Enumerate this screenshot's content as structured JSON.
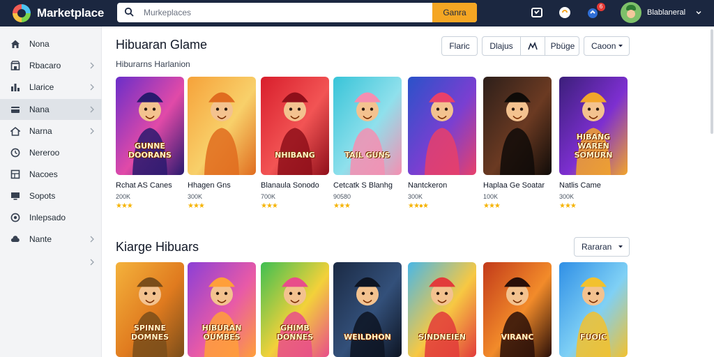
{
  "header": {
    "brand": "Marketplace",
    "search_placeholder": "Murkeplaces",
    "search_button": "Ganra",
    "username": "Blablaneral"
  },
  "sidebar": {
    "items": [
      {
        "label": "Nona",
        "icon": "home-icon",
        "chevron": false
      },
      {
        "label": "Rbacaro",
        "icon": "store-icon",
        "chevron": true
      },
      {
        "label": "Llarice",
        "icon": "bar-chart-icon",
        "chevron": true
      },
      {
        "label": "Nana",
        "icon": "card-icon",
        "chevron": true,
        "active": true
      },
      {
        "label": "Narna",
        "icon": "house-icon",
        "chevron": true
      },
      {
        "label": "Nereroo",
        "icon": "clock-icon",
        "chevron": false
      },
      {
        "label": "Nacoes",
        "icon": "grid-icon",
        "chevron": false
      },
      {
        "label": "Sopots",
        "icon": "monitor-icon",
        "chevron": false
      },
      {
        "label": "Inlepsado",
        "icon": "globe-icon",
        "chevron": false
      },
      {
        "label": "Nante",
        "icon": "cloud-icon",
        "chevron": true
      }
    ]
  },
  "section1": {
    "title": "Hibuaran Glame",
    "subtitle": "Hiburarns Harlanion",
    "filters": {
      "single": "Flaric",
      "group": [
        "Dlajus",
        "Pbüge"
      ],
      "select": "Caoon"
    },
    "cards": [
      {
        "title": "Rchat AS Canes",
        "meta": "200K",
        "stars": "★★★",
        "art_text": "GUNNE DOORANS",
        "colors": [
          "#6a2ec9",
          "#e14aa8",
          "#2a1a6e"
        ]
      },
      {
        "title": "Hhagen Gns",
        "meta": "300K",
        "stars": "★★★",
        "art_text": "",
        "colors": [
          "#f6a23a",
          "#f8d06a",
          "#e06c1f"
        ]
      },
      {
        "title": "Blanaula Sonodo",
        "meta": "700K",
        "stars": "★★★",
        "art_text": "NHIBANG",
        "colors": [
          "#d81e2c",
          "#f25454",
          "#8f0f1a"
        ]
      },
      {
        "title": "Cetcatk S Blanhg",
        "meta": "90580",
        "stars": "★★★",
        "art_text": "TAIL GUNS",
        "colors": [
          "#38c4d8",
          "#8fe0ec",
          "#f48fb1"
        ]
      },
      {
        "title": "Nantckeron",
        "meta": "300K",
        "stars": "★★●★",
        "art_text": "",
        "colors": [
          "#2a52c9",
          "#7a3fd1",
          "#e8406a"
        ]
      },
      {
        "title": "Haplaa Ge Soatar",
        "meta": "100K",
        "stars": "★★★",
        "art_text": "",
        "colors": [
          "#2d1f1a",
          "#6b3a22",
          "#0f0b08"
        ]
      },
      {
        "title": "Natlis Came",
        "meta": "300K",
        "stars": "★★★",
        "art_text": "HIBANG WAREN SOMURN",
        "colors": [
          "#3b1f7a",
          "#7d2fd0",
          "#f2a52b"
        ]
      }
    ]
  },
  "section2": {
    "title": "Kiarge Hibuars",
    "select": "Rararan",
    "cards": [
      {
        "art_text": "SPINNE DOMNES",
        "colors": [
          "#f4b23c",
          "#e07b1f",
          "#7a4d1a"
        ]
      },
      {
        "art_text": "HIBURAN OUMBES",
        "colors": [
          "#8b3fd6",
          "#e85aa7",
          "#ff9f3a"
        ]
      },
      {
        "art_text": "GHIMB DONNES",
        "colors": [
          "#3fbf52",
          "#f3d13a",
          "#e84d8a"
        ]
      },
      {
        "art_text": "WEILDHON",
        "colors": [
          "#1b2a44",
          "#33507a",
          "#0d1422"
        ]
      },
      {
        "art_text": "SINDNEIEN",
        "colors": [
          "#49b7e6",
          "#f7c843",
          "#e23b3b"
        ]
      },
      {
        "art_text": "VIRANC",
        "colors": [
          "#c23a1a",
          "#f28b2a",
          "#2a0f08"
        ]
      },
      {
        "art_text": "FUOIC",
        "colors": [
          "#2f8fe6",
          "#7fd0f5",
          "#f2c12e"
        ]
      }
    ]
  },
  "colors": {
    "topbar": "#1b2740",
    "accent": "#f5a623",
    "sidebar_bg": "#f3f4f6",
    "stars": "#f5b301"
  }
}
